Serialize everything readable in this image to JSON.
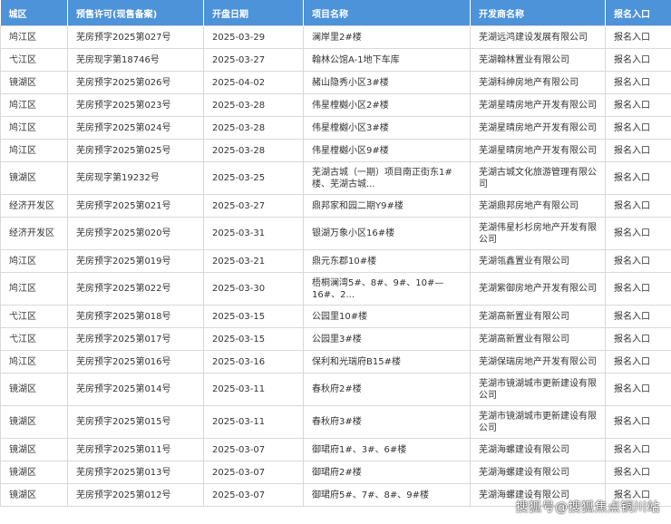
{
  "columns": [
    "城区",
    "预售许可(现售备案)",
    "开盘日期",
    "项目名称",
    "开发商名称",
    "报名入口"
  ],
  "rows": [
    {
      "district": "鸠江区",
      "permit": "芜房预字2025第027号",
      "date": "2025-03-29",
      "project": "澜岸里2#楼",
      "developer": "芜湖远鸿建设发展有限公司",
      "entry": "报名入口"
    },
    {
      "district": "弋江区",
      "permit": "芜房现字第18746号",
      "date": "2025-03-27",
      "project": "翰林公馆A-1地下车库",
      "developer": "芜湖翰林置业有限公司",
      "entry": "报名入口"
    },
    {
      "district": "镜湖区",
      "permit": "芜房预字2025第026号",
      "date": "2025-04-02",
      "project": "赭山隐秀小区3#楼",
      "developer": "芜湖科绅房地产有限公司",
      "entry": "报名入口"
    },
    {
      "district": "鸠江区",
      "permit": "芜房预字2025第023号",
      "date": "2025-03-28",
      "project": "伟星樘樾小区2#楼",
      "developer": "芜湖星晴房地产开发有限公司",
      "entry": "报名入口"
    },
    {
      "district": "鸠江区",
      "permit": "芜房预字2025第024号",
      "date": "2025-03-28",
      "project": "伟星樘樾小区3#楼",
      "developer": "芜湖星晴房地产开发有限公司",
      "entry": "报名入口"
    },
    {
      "district": "鸠江区",
      "permit": "芜房预字2025第025号",
      "date": "2025-03-28",
      "project": "伟星樘樾小区9#楼",
      "developer": "芜湖星晴房地产开发有限公司",
      "entry": "报名入口"
    },
    {
      "district": "镜湖区",
      "permit": "芜房现字第19232号",
      "date": "2025-03-25",
      "project": "芜湖古城（一期）项目南正街东1#楼、芜湖古城...",
      "developer": "芜湖古城文化旅游管理有限公司",
      "entry": "报名入口"
    },
    {
      "district": "经济开发区",
      "permit": "芜房预字2025第021号",
      "date": "2025-03-27",
      "project": "鼎邦家和园二期Y9#楼",
      "developer": "芜湖鼎邦房地产有限公司",
      "entry": "报名入口"
    },
    {
      "district": "经济开发区",
      "permit": "芜房预字2025第020号",
      "date": "2025-03-31",
      "project": "银湖万象小区16#楼",
      "developer": "芜湖伟星杉杉房地产开发有限公司",
      "entry": "报名入口"
    },
    {
      "district": "鸠江区",
      "permit": "芜房预字2025第019号",
      "date": "2025-03-21",
      "project": "鼎元东郡10#楼",
      "developer": "芜湖瓴鑫置业有限公司",
      "entry": "报名入口"
    },
    {
      "district": "鸠江区",
      "permit": "芜房预字2025第022号",
      "date": "2025-03-30",
      "project": "梧桐澜湾5#、8#、9#、10#—16#、2...",
      "developer": "芜湖紫御房地产开发有限公司",
      "entry": "报名入口"
    },
    {
      "district": "弋江区",
      "permit": "芜房预字2025第018号",
      "date": "2025-03-15",
      "project": "公园里10#楼",
      "developer": "芜湖高新置业有限公司",
      "entry": "报名入口"
    },
    {
      "district": "弋江区",
      "permit": "芜房预字2025第017号",
      "date": "2025-03-15",
      "project": "公园里3#楼",
      "developer": "芜湖高新置业有限公司",
      "entry": "报名入口"
    },
    {
      "district": "鸠江区",
      "permit": "芜房预字2025第016号",
      "date": "2025-03-16",
      "project": "保利和光瑞府B15#楼",
      "developer": "芜湖保瑞房地产开发有限公司",
      "entry": "报名入口"
    },
    {
      "district": "镜湖区",
      "permit": "芜房预字2025第014号",
      "date": "2025-03-11",
      "project": "春秋府2#楼",
      "developer": "芜湖市镜湖城市更新建设有限公司",
      "entry": "报名入口"
    },
    {
      "district": "镜湖区",
      "permit": "芜房预字2025第015号",
      "date": "2025-03-11",
      "project": "春秋府3#楼",
      "developer": "芜湖市镜湖城市更新建设有限公司",
      "entry": "报名入口"
    },
    {
      "district": "镜湖区",
      "permit": "芜房预字2025第011号",
      "date": "2025-03-07",
      "project": "御珺府1#、3#、6#楼",
      "developer": "芜湖海螺建设有限公司",
      "entry": "报名入口"
    },
    {
      "district": "镜湖区",
      "permit": "芜房预字2025第013号",
      "date": "2025-03-07",
      "project": "御珺府2#楼",
      "developer": "芜湖海螺建设有限公司",
      "entry": "报名入口"
    },
    {
      "district": "镜湖区",
      "permit": "芜房预字2025第012号",
      "date": "2025-03-07",
      "project": "御珺府5#、7#、8#、9#楼",
      "developer": "芜湖海螺建设有限公司",
      "entry": "报名入口"
    }
  ],
  "watermark": "搜狐号@搜狐焦点铜川站"
}
